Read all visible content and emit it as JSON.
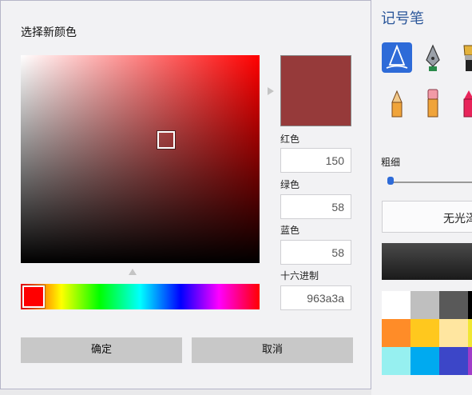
{
  "dialog": {
    "title": "选择新颜色",
    "fields": {
      "red": {
        "label": "红色",
        "value": "150"
      },
      "green": {
        "label": "绿色",
        "value": "58"
      },
      "blue": {
        "label": "蓝色",
        "value": "58"
      },
      "hex": {
        "label": "十六进制",
        "value": "963a3a"
      }
    },
    "preview_color": "#963a3a",
    "hue_color": "#ff0000",
    "buttons": {
      "ok": "确定",
      "cancel": "取消"
    }
  },
  "side_panel": {
    "title": "记号笔",
    "pens": [
      {
        "icon": "calligraphy-pen-icon",
        "selected": true
      },
      {
        "icon": "fountain-pen-icon",
        "selected": false
      },
      {
        "icon": "paint-brush-icon",
        "selected": false
      },
      {
        "icon": "pencil-icon",
        "selected": false
      },
      {
        "icon": "eraser-marker-icon",
        "selected": false
      },
      {
        "icon": "crayon-icon",
        "selected": false
      }
    ],
    "thickness_label": "粗细",
    "button_label": "无光泽",
    "swatches": [
      [
        "#ffffff",
        "#bfbfbf",
        "#595959",
        "#000000"
      ],
      [
        "#ff8c28",
        "#ffc81e",
        "#ffe6a0",
        "#f0e632"
      ],
      [
        "#96f0f0",
        "#00aaf0",
        "#3c46c8",
        "#a03cc8"
      ]
    ]
  }
}
